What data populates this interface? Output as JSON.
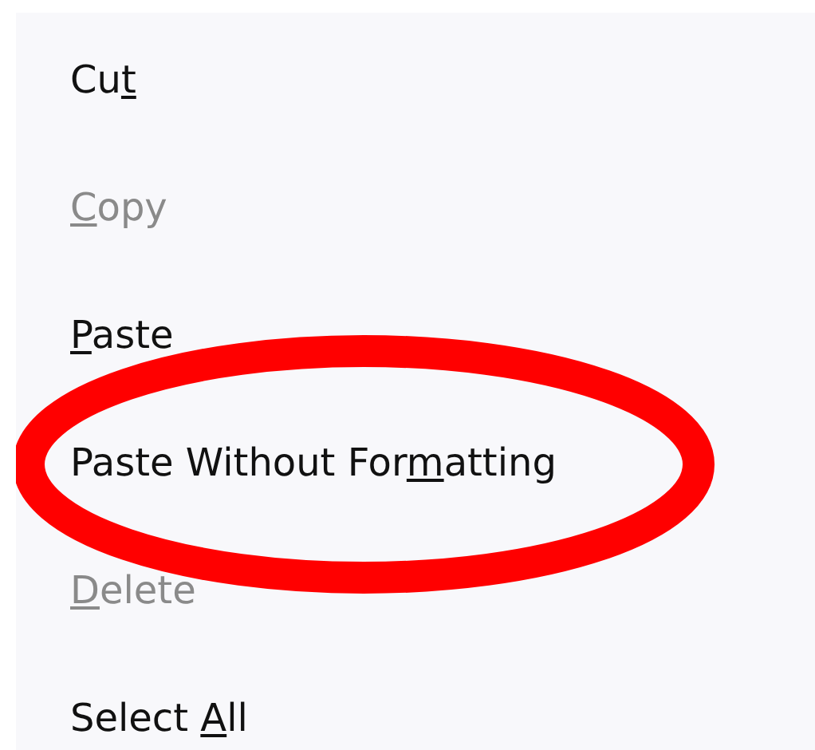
{
  "menu": {
    "items": [
      {
        "before": "Cu",
        "access_key": "t",
        "disabled": false
      },
      {
        "access_key": "C",
        "after": "opy",
        "disabled": true
      },
      {
        "access_key": "P",
        "after": "aste",
        "disabled": false
      },
      {
        "before": "Paste Without For",
        "access_key": "m",
        "after": "atting",
        "disabled": false
      },
      {
        "access_key": "D",
        "after": "elete",
        "disabled": true
      },
      {
        "before": "Select ",
        "access_key": "A",
        "after": "ll",
        "disabled": false
      }
    ]
  },
  "annotation": {
    "kind": "ellipse"
  }
}
